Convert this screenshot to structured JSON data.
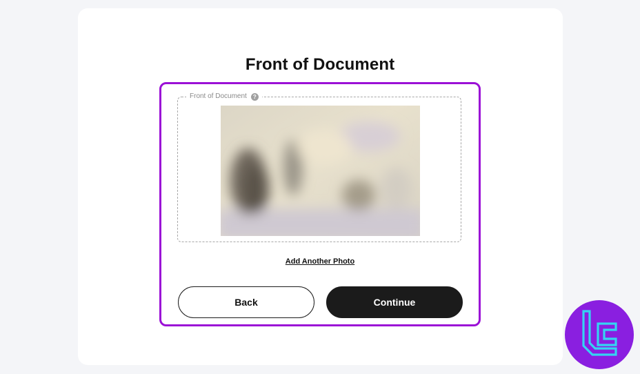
{
  "page": {
    "title": "Front of Document"
  },
  "upload": {
    "legend": "Front of Document",
    "help_icon_glyph": "?",
    "image_description": "blurred photo of an identity document"
  },
  "links": {
    "add_another_photo": "Add Another Photo"
  },
  "buttons": {
    "back": "Back",
    "continue": "Continue"
  },
  "colors": {
    "highlight": "#9b10d6",
    "primary_button": "#1b1b1b",
    "logo_bg": "#8a1fe0",
    "logo_mark": "#34d4f2"
  },
  "icons": {
    "help": "question-circle-icon",
    "logo": "brand-logo-icon"
  }
}
